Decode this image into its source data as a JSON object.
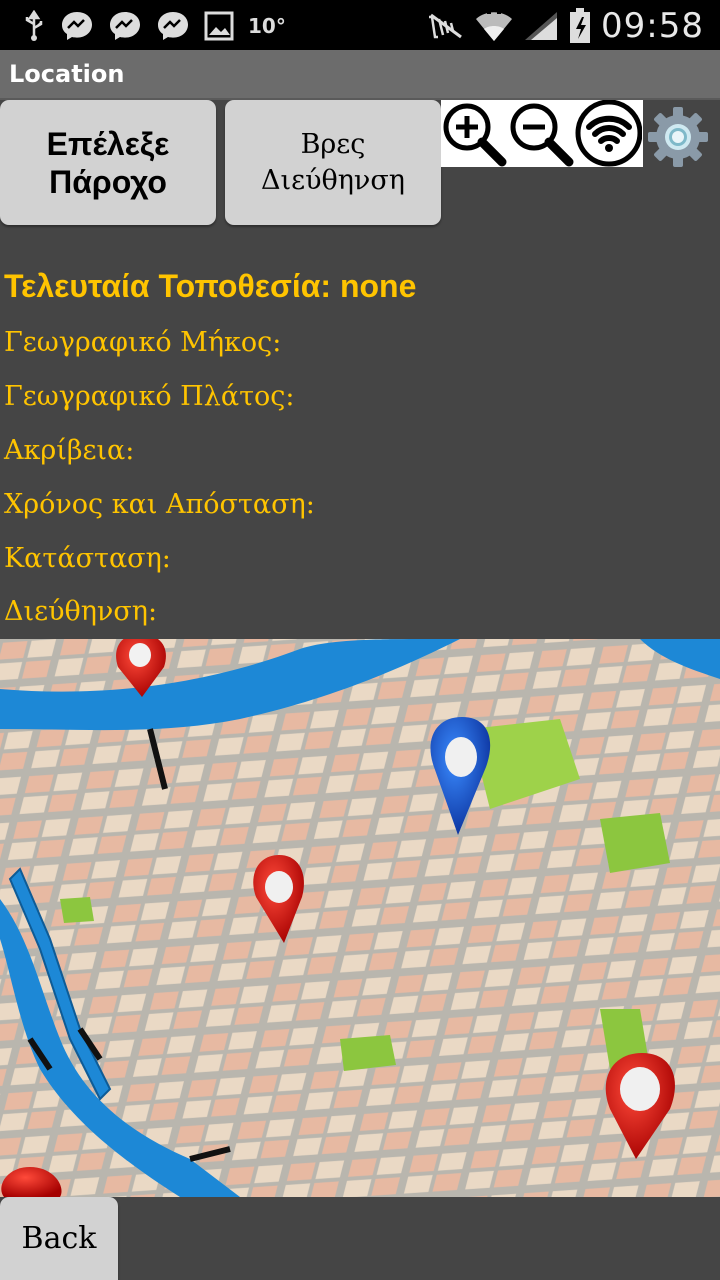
{
  "status_bar": {
    "temperature": "10°",
    "time": "09:58",
    "icons": [
      "usb-icon",
      "messenger-icon",
      "messenger-icon",
      "messenger-icon",
      "gallery-icon",
      "mute-icon",
      "wifi-icon",
      "signal-icon",
      "battery-icon"
    ]
  },
  "app": {
    "title": "Location"
  },
  "buttons": {
    "select_provider": "Επέλεξε Πάροχο",
    "find_address": "Βρες Διεύθηνση",
    "back": "Back"
  },
  "toolbar": {
    "icons": [
      "zoom-in-icon",
      "zoom-out-icon",
      "wifi-icon",
      "settings-icon"
    ]
  },
  "info": {
    "last_location": "Τελευταία Τοποθεσία: none",
    "longitude": "Γεωγραφικό Μήκος:",
    "latitude": "Γεωγραφικό Πλάτος:",
    "accuracy": "Ακρίβεια:",
    "time_distance": "Χρόνος και Απόσταση:",
    "status": "Κατάσταση:",
    "address": "Διεύθηνση:"
  },
  "colors": {
    "info_text": "#ffc400",
    "background": "#454545",
    "button_bg": "#d2d2d2",
    "titlebar": "#6c6c6c"
  }
}
